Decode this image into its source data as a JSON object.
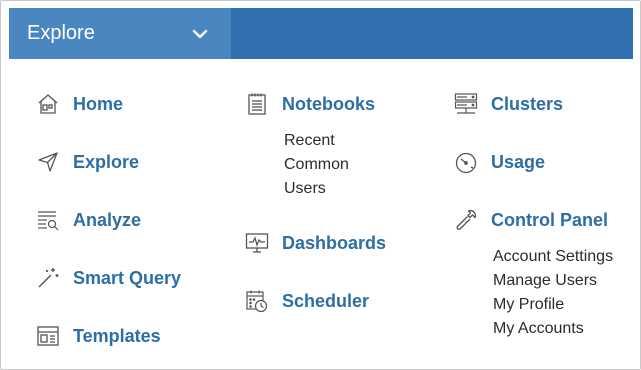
{
  "header": {
    "dropdown_label": "Explore",
    "chevron_icon": "chevron-down-icon",
    "accent_color": "#3070ae",
    "button_color": "#4a86bf"
  },
  "menu": {
    "col1": [
      {
        "label": "Home",
        "icon": "home-icon"
      },
      {
        "label": "Explore",
        "icon": "paper-plane-icon"
      },
      {
        "label": "Analyze",
        "icon": "list-search-icon"
      },
      {
        "label": "Smart Query",
        "icon": "magic-wand-icon"
      },
      {
        "label": "Templates",
        "icon": "layout-template-icon"
      }
    ],
    "col2": [
      {
        "label": "Notebooks",
        "icon": "notebook-icon",
        "sub": [
          "Recent",
          "Common",
          "Users"
        ]
      },
      {
        "label": "Dashboards",
        "icon": "monitor-chart-icon"
      },
      {
        "label": "Scheduler",
        "icon": "calendar-clock-icon"
      }
    ],
    "col3": [
      {
        "label": "Clusters",
        "icon": "server-stack-icon"
      },
      {
        "label": "Usage",
        "icon": "speedometer-icon"
      },
      {
        "label": "Control Panel",
        "icon": "wrench-icon",
        "sub": [
          "Account Settings",
          "Manage Users",
          "My Profile",
          "My Accounts"
        ]
      }
    ],
    "link_color": "#2d6ea5"
  }
}
